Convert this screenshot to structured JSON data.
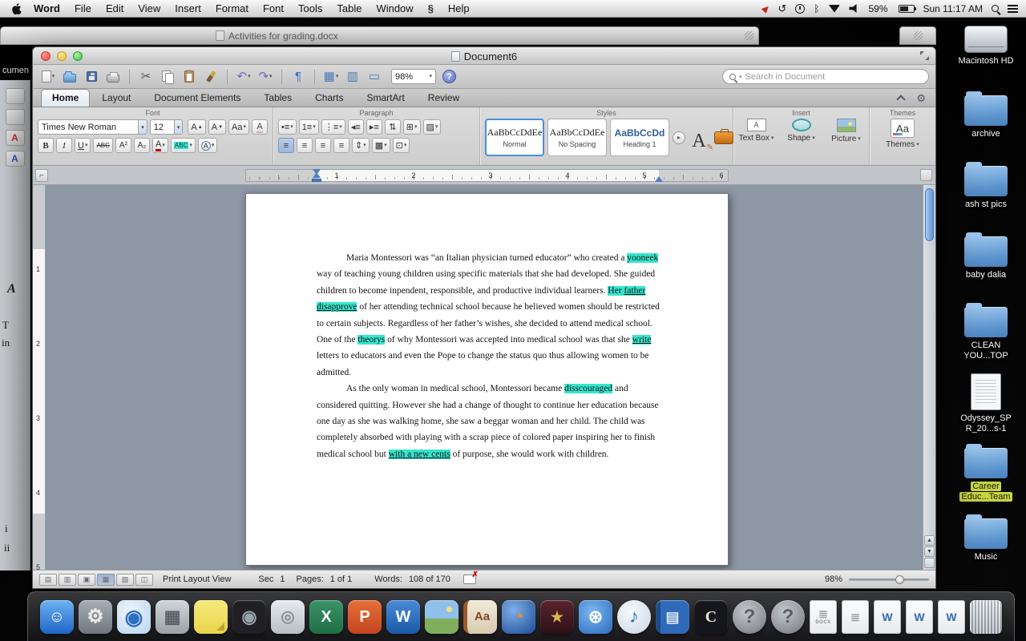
{
  "menu_bar": {
    "app_name": "Word",
    "items": [
      "File",
      "Edit",
      "View",
      "Insert",
      "Format",
      "Font",
      "Tools",
      "Table",
      "Window",
      "Help"
    ],
    "battery": "59%",
    "clock": "Sun 11:17 AM"
  },
  "background_window": {
    "title": "Activities for grading.docx",
    "desktop_label_fragment": "cumen",
    "document_fragments": [
      "A",
      "T",
      "in",
      "i",
      "ii"
    ]
  },
  "word_window": {
    "title": "Document6",
    "toolbar": {
      "zoom": "98%",
      "search_placeholder": "Search in Document",
      "icons": [
        {
          "name": "new-document",
          "css": "ic-page",
          "caret": true
        },
        {
          "name": "open-document",
          "css": "ic-folder"
        },
        {
          "name": "save-document",
          "css": "ic-floppy"
        },
        {
          "name": "print-document",
          "css": "ic-printer"
        },
        {
          "sep": true
        },
        {
          "name": "cut",
          "glyph": "✂",
          "color": "#555555"
        },
        {
          "name": "copy",
          "css": "ic-copy"
        },
        {
          "name": "paste",
          "css": "ic-clipboard"
        },
        {
          "name": "format-painter",
          "css": "ic-brush"
        },
        {
          "sep": true
        },
        {
          "name": "undo",
          "glyph": "↶",
          "color": "#7a5fd0",
          "caret": true
        },
        {
          "name": "redo",
          "glyph": "↷",
          "color": "#7a5fd0",
          "caret": true
        },
        {
          "sep": true
        },
        {
          "name": "show-formatting-marks",
          "glyph": "¶",
          "color": "#3a6fc4"
        },
        {
          "sep": true
        },
        {
          "name": "tables",
          "glyph": "▦",
          "color": "#4a7ab8",
          "caret": true
        },
        {
          "name": "columns",
          "glyph": "▥",
          "color": "#4a7ab8"
        },
        {
          "name": "text-box",
          "glyph": "▭",
          "color": "#4a7ab8"
        }
      ]
    },
    "tabs": [
      {
        "label": "Home",
        "active": true
      },
      {
        "label": "Layout"
      },
      {
        "label": "Document Elements"
      },
      {
        "label": "Tables"
      },
      {
        "label": "Charts"
      },
      {
        "label": "SmartArt"
      },
      {
        "label": "Review"
      }
    ],
    "ribbon": {
      "group_labels": [
        "Font",
        "Paragraph",
        "Styles",
        "Insert",
        "Themes"
      ],
      "font": {
        "family": "Times New Roman",
        "size": "12",
        "row1": [
          {
            "name": "grow-font",
            "t": "A",
            "sup": "▲"
          },
          {
            "name": "shrink-font",
            "t": "A",
            "sup": "▼"
          },
          {
            "name": "change-case",
            "t": "Aa",
            "caret": true
          },
          {
            "name": "clear-formatting",
            "t": "A",
            "cls": "bclear"
          }
        ],
        "row2": [
          {
            "name": "bold",
            "t": "B",
            "cls": "bb"
          },
          {
            "name": "italic",
            "t": "I",
            "cls": "bi"
          },
          {
            "name": "underline",
            "t": "U",
            "cls": "bu",
            "caret": true
          },
          {
            "name": "strikethrough",
            "t": "ABC",
            "cls": "bs"
          },
          {
            "name": "superscript",
            "t": "A²",
            "cls": "bsmall"
          },
          {
            "name": "subscript",
            "t": "A₂",
            "cls": "bsmall"
          },
          {
            "name": "font-color",
            "t": "A",
            "cls": "bfc",
            "caret": true
          },
          {
            "name": "text-highlight-color",
            "t": "ABC",
            "cls": "bhl",
            "caret": true
          },
          {
            "name": "character-border",
            "t": "A",
            "cls": "bring",
            "caret": true
          }
        ]
      },
      "paragraph": {
        "row1": [
          {
            "name": "bullets",
            "g": "•≡",
            "caret": true
          },
          {
            "name": "numbering",
            "g": "1≡",
            "caret": true
          },
          {
            "name": "multilevel-list",
            "g": "⋮≡",
            "caret": true
          },
          {
            "name": "decrease-indent",
            "g": "◂≡"
          },
          {
            "name": "increase-indent",
            "g": "▸≡"
          },
          {
            "name": "sort",
            "g": "⇅"
          },
          {
            "name": "borders",
            "g": "⊞",
            "caret": true
          },
          {
            "name": "shading",
            "g": "▨",
            "caret": true
          }
        ],
        "row2": [
          {
            "name": "align-left",
            "g": "≡",
            "active": true
          },
          {
            "name": "align-center",
            "g": "≡"
          },
          {
            "name": "align-right",
            "g": "≡"
          },
          {
            "name": "justify",
            "g": "≡"
          },
          {
            "name": "line-spacing",
            "g": "⇕",
            "caret": true
          },
          {
            "name": "fill-color",
            "g": "▩",
            "caret": true
          },
          {
            "name": "box-border",
            "g": "⊡",
            "caret": true
          }
        ]
      },
      "styles": {
        "cards": [
          {
            "preview": "AaBbCcDdEe",
            "label": "Normal",
            "selected": true
          },
          {
            "preview": "AaBbCcDdEe",
            "label": "No Spacing"
          },
          {
            "preview": "AaBbCcDd",
            "label": "Heading 1",
            "heading": true
          }
        ]
      },
      "insert": {
        "items": [
          {
            "label": "Text Box",
            "icon": "textbox"
          },
          {
            "label": "Shape",
            "icon": "shape"
          },
          {
            "label": "Picture",
            "icon": "picture"
          }
        ]
      },
      "themes": {
        "label": "Themes",
        "icon_text": "Aa"
      }
    },
    "ruler": {
      "h_numbers": [
        "1",
        "2",
        "3",
        "4",
        "5",
        "6"
      ],
      "v_numbers": [
        "1",
        "2",
        "3",
        "4",
        "5"
      ]
    },
    "status_bar": {
      "view_label": "Print Layout View",
      "sec_label": "Sec",
      "sec_value": "1",
      "pages_label": "Pages:",
      "pages_value": "1 of 1",
      "words_label": "Words:",
      "words_value": "108 of 170",
      "zoom": "98%",
      "view_buttons": [
        {
          "name": "draft-view",
          "g": "▤"
        },
        {
          "name": "outline-view",
          "g": "▥"
        },
        {
          "name": "publishing-layout-view",
          "g": "▣"
        },
        {
          "name": "print-layout-view",
          "g": "▦",
          "active": true
        },
        {
          "name": "notebook-layout-view",
          "g": "▧"
        },
        {
          "name": "full-screen-view",
          "g": "◫"
        }
      ]
    }
  },
  "document": {
    "highlight_color": "#35e6cf",
    "paragraphs": [
      {
        "segments": [
          {
            "text": "Maria Montessori was  “an Italian physician turned educator” who created a "
          },
          {
            "text": "yooneek",
            "highlight": true
          },
          {
            "text": " way of teaching young children using specific materials that she had developed. She guided children to become inpendent, responsible, and productive individual learners. "
          },
          {
            "text": "Her ",
            "highlight": true
          },
          {
            "text": "father disapprove",
            "highlight": true,
            "underline": true
          },
          {
            "text": " of her attending technical school because he believed women should be restricted to certain subjects. Regardless of her father’s wishes, she decided to attend medical school. One of the "
          },
          {
            "text": "theorys",
            "highlight": true
          },
          {
            "text": " of why Montessori was accepted into medical school was that she "
          },
          {
            "text": "write",
            "highlight": true,
            "underline": true
          },
          {
            "text": " letters to educators and even the Pope to change the status quo thus allowing women to be admitted."
          }
        ]
      },
      {
        "segments": [
          {
            "text": "As the only woman in medical school, Montessori became "
          },
          {
            "text": "disscouraged",
            "highlight": true
          },
          {
            "text": " and considered quitting. However she had a change of thought to continue her education because one day as she was walking home, she saw a beggar woman and her child. The child was completely absorbed with playing with a scrap piece of colored paper inspiring her to finish medical school but "
          },
          {
            "text": "with a new cents",
            "highlight": true,
            "underline": true
          },
          {
            "text": " of purpose, she would work with children."
          }
        ]
      }
    ]
  },
  "desktop_icons": [
    {
      "label": "Macintosh HD",
      "type": "drive"
    },
    {
      "label": "archive",
      "type": "folder"
    },
    {
      "label": "ash st pics",
      "type": "folder"
    },
    {
      "label": "baby dalia",
      "type": "folder"
    },
    {
      "label": "CLEAN YOU...TOP",
      "type": "folder"
    },
    {
      "label": "Odyssey_SP R_20...s-1",
      "type": "doc"
    },
    {
      "label": "Career Educ...Team",
      "type": "folder",
      "selected": true
    },
    {
      "label": "Music",
      "type": "folder"
    }
  ],
  "dock_items": [
    {
      "name": "finder",
      "cls": "dk-finder",
      "g": "☺"
    },
    {
      "name": "system-preferences",
      "cls": "dk-prefs",
      "g": "⚙"
    },
    {
      "name": "safari",
      "cls": "dk-safari",
      "g": "◉"
    },
    {
      "name": "launchpad",
      "cls": "dk-keypad",
      "g": "▦"
    },
    {
      "name": "stickies",
      "cls": "dk-stickies"
    },
    {
      "name": "dvd-player",
      "cls": "dk-dvd",
      "g": "◉"
    },
    {
      "name": "ipod",
      "cls": "dk-ipod",
      "g": "◎"
    },
    {
      "name": "excel",
      "cls": "dk-excel",
      "g": "X"
    },
    {
      "name": "powerpoint",
      "cls": "dk-ppt",
      "g": "P"
    },
    {
      "name": "word",
      "cls": "dk-word",
      "g": "W"
    },
    {
      "name": "iphoto",
      "cls": "dk-photo"
    },
    {
      "name": "dictionary",
      "cls": "dk-dict",
      "g": "Aa"
    },
    {
      "name": "firefox",
      "cls": "dk-firefox",
      "g": "◔"
    },
    {
      "name": "imovie",
      "cls": "dk-imovie",
      "g": "★"
    },
    {
      "name": "mind-app",
      "cls": "dk-mind",
      "g": "⊛"
    },
    {
      "name": "itunes",
      "cls": "dk-itunes",
      "g": "♪"
    },
    {
      "name": "notebook",
      "cls": "dk-notebook",
      "g": "▤"
    },
    {
      "name": "c-application",
      "cls": "dk-capp",
      "g": "C"
    },
    {
      "name": "unknown-app-1",
      "cls": "dk-qmark",
      "g": "?"
    },
    {
      "name": "unknown-app-2",
      "cls": "dk-qmark",
      "g": "?"
    },
    {
      "name": "docx-document",
      "cls": "dk-doc dk-doctext",
      "g": "≣",
      "sub": "DOCX"
    },
    {
      "name": "text-document",
      "cls": "dk-doc dk-doctext",
      "g": "≣"
    },
    {
      "name": "word-document-1",
      "cls": "dk-doc",
      "g": "W"
    },
    {
      "name": "word-document-2",
      "cls": "dk-doc",
      "g": "W"
    },
    {
      "name": "word-document-3",
      "cls": "dk-doc",
      "g": "W"
    },
    {
      "name": "trash",
      "cls": "dk-trash"
    }
  ]
}
